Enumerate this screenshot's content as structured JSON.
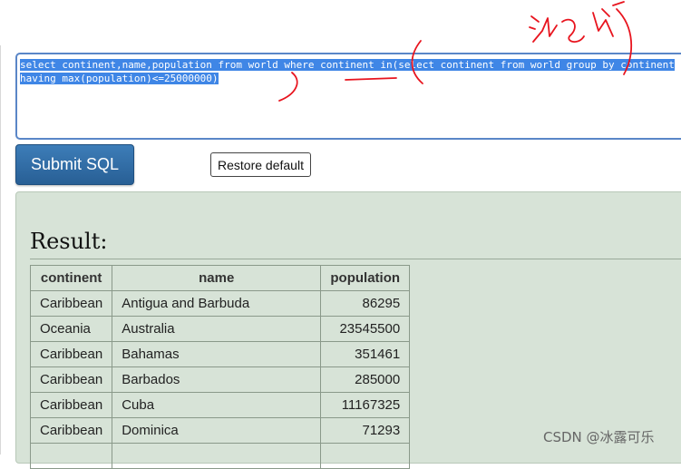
{
  "sql": {
    "query": "select continent,name,population from world where continent in(select continent from world group by continent having max(population)<=25000000)"
  },
  "buttons": {
    "submit_label": "Submit SQL",
    "restore_label": "Restore default"
  },
  "result": {
    "title": "Result:",
    "columns": [
      "continent",
      "name",
      "population"
    ],
    "rows": [
      [
        "Caribbean",
        "Antigua and Barbuda",
        "86295"
      ],
      [
        "Oceania",
        "Australia",
        "23545500"
      ],
      [
        "Caribbean",
        "Bahamas",
        "351461"
      ],
      [
        "Caribbean",
        "Barbados",
        "285000"
      ],
      [
        "Caribbean",
        "Cuba",
        "11167325"
      ],
      [
        "Caribbean",
        "Dominica",
        "71293"
      ]
    ]
  },
  "watermark": "CSDN @冰露可乐",
  "annotation_color": "#e8141e"
}
